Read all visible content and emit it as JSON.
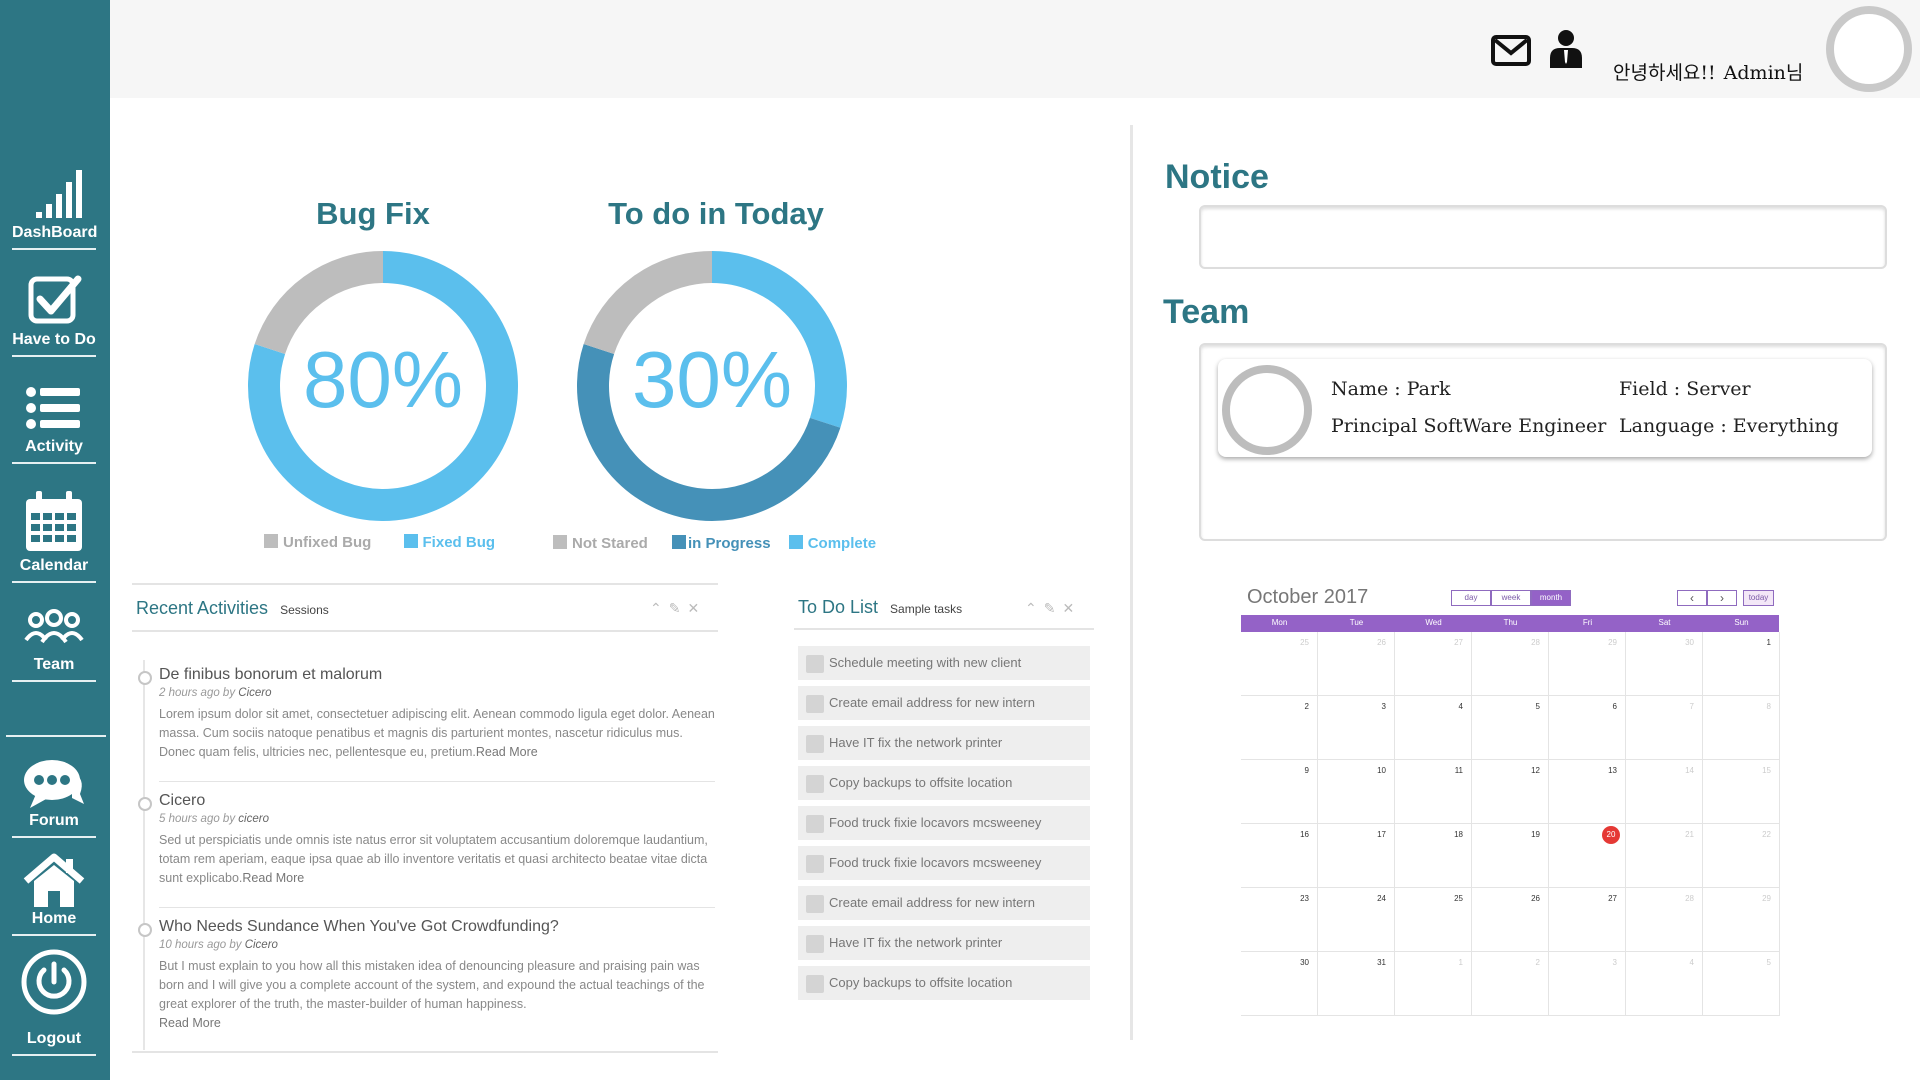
{
  "sidebar": {
    "items": [
      {
        "label": "DashBoard",
        "icon": "signal-bars-icon"
      },
      {
        "label": "Have to Do",
        "icon": "checkbox-icon"
      },
      {
        "label": "Activity",
        "icon": "list-icon"
      },
      {
        "label": "Calendar",
        "icon": "calendar-icon"
      },
      {
        "label": "Team",
        "icon": "team-icon"
      },
      {
        "label": "Forum",
        "icon": "chat-bubble-icon"
      },
      {
        "label": "Home",
        "icon": "home-icon"
      },
      {
        "label": "Logout",
        "icon": "power-icon"
      }
    ],
    "color": "#2d7684"
  },
  "topbar": {
    "greeting": "안녕하세요!!",
    "user": "Admin님",
    "icons": [
      "mail-icon",
      "user-icon",
      "avatar"
    ]
  },
  "bugfix": {
    "title": "Bug Fix",
    "value_label": "80%",
    "legend": [
      "Unfixed Bug",
      "Fixed Bug"
    ]
  },
  "todo_today": {
    "title": "To do in Today",
    "value_label": "30%",
    "legend": [
      "Not Stared",
      "in Progress",
      "Complete"
    ]
  },
  "chart_data": [
    {
      "type": "pie",
      "title": "Bug Fix",
      "categories": [
        "Fixed Bug",
        "Unfixed Bug"
      ],
      "values": [
        80,
        20
      ],
      "colors": [
        "#5bbfed",
        "#bdbdbd"
      ]
    },
    {
      "type": "pie",
      "title": "To do in Today",
      "categories": [
        "Complete",
        "in Progress",
        "Not Stared"
      ],
      "values": [
        30,
        50,
        20
      ],
      "colors": [
        "#5bbfed",
        "#4591b8",
        "#bdbdbd"
      ]
    }
  ],
  "activities": {
    "title": "Recent Activities",
    "subtitle": "Sessions",
    "items": [
      {
        "title": "De finibus bonorum et malorum",
        "time": "2 hours ago by",
        "author": "Cicero",
        "text": "Lorem ipsum dolor sit amet, consectetuer adipiscing elit. Aenean commodo ligula eget dolor. Aenean massa. Cum sociis natoque penatibus et magnis dis parturient montes, nascetur ridiculus mus. Donec quam felis, ultricies nec, pellentesque eu, pretium.",
        "more": "Read More"
      },
      {
        "title": "Cicero",
        "time": "5 hours ago by",
        "author": "cicero",
        "text": "Sed ut perspiciatis unde omnis iste natus error sit voluptatem accusantium doloremque laudantium, totam rem aperiam, eaque ipsa quae ab illo inventore veritatis et quasi architecto beatae vitae dicta sunt explicabo.",
        "more": "Read More"
      },
      {
        "title": "Who Needs Sundance When You've Got Crowdfunding?",
        "time": "10 hours ago by",
        "author": "Cicero",
        "text": "But I must explain to you how all this mistaken idea of denouncing pleasure and praising pain was born and I will give you a complete account of the system, and expound the actual teachings of the great explorer of the truth, the master-builder of human happiness.",
        "more": "Read More"
      }
    ]
  },
  "todo_list": {
    "title": "To Do List",
    "subtitle": "Sample tasks",
    "items": [
      "Schedule meeting with new client",
      "Create email address for new intern",
      "Have IT fix the network printer",
      "Copy backups to offsite location",
      "Food truck fixie locavors mcsweeney",
      "Food truck fixie locavors mcsweeney",
      "Create email address for new intern",
      "Have IT fix the network printer",
      "Copy backups to offsite location"
    ]
  },
  "notice": {
    "title": "Notice",
    "content": ""
  },
  "team": {
    "title": "Team",
    "name": "Name : Park",
    "role": "Principal SoftWare Engineer",
    "field": "Field : Server",
    "language": "Language : Everything"
  },
  "calendar": {
    "title": "October 2017",
    "views": [
      "day",
      "week",
      "month"
    ],
    "active_view": "month",
    "nav": {
      "prev": "‹",
      "next": "›",
      "today": "today"
    },
    "weekdays": [
      "Mon",
      "Tue",
      "Wed",
      "Thu",
      "Fri",
      "Sat",
      "Sun"
    ],
    "weeks": [
      [
        "25",
        "26",
        "27",
        "28",
        "29",
        "30",
        "1"
      ],
      [
        "2",
        "3",
        "4",
        "5",
        "6",
        "7",
        "8"
      ],
      [
        "9",
        "10",
        "11",
        "12",
        "13",
        "14",
        "15"
      ],
      [
        "16",
        "17",
        "18",
        "19",
        "20",
        "21",
        "22"
      ],
      [
        "23",
        "24",
        "25",
        "26",
        "27",
        "28",
        "29"
      ],
      [
        "30",
        "31",
        "1",
        "2",
        "3",
        "4",
        "5"
      ]
    ],
    "today": "20",
    "accent": "#9462c7"
  }
}
